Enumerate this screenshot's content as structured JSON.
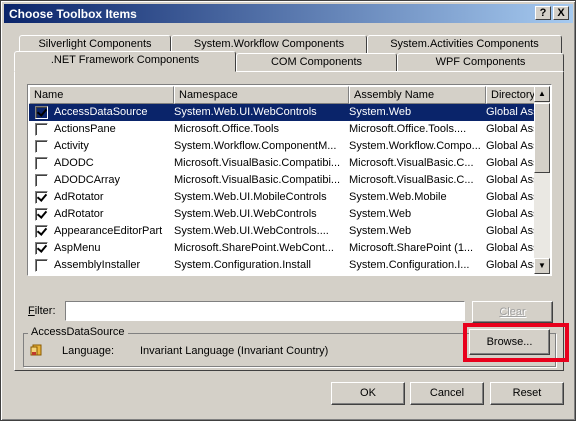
{
  "window": {
    "title": "Choose Toolbox Items",
    "help_label": "?",
    "close_label": "X"
  },
  "tabs_row1": [
    {
      "label": "Silverlight Components"
    },
    {
      "label": "System.Workflow Components"
    },
    {
      "label": "System.Activities Components"
    }
  ],
  "tabs_row2": [
    {
      "label": ".NET Framework Components",
      "active": true
    },
    {
      "label": "COM Components"
    },
    {
      "label": "WPF Components"
    }
  ],
  "list": {
    "columns": [
      "Name",
      "Namespace",
      "Assembly Name",
      "Directory"
    ],
    "rows": [
      {
        "checked": true,
        "name": "AccessDataSource",
        "namespace": "System.Web.UI.WebControls",
        "assembly": "System.Web",
        "directory": "Global Ass",
        "selected": true
      },
      {
        "checked": false,
        "name": "ActionsPane",
        "namespace": "Microsoft.Office.Tools",
        "assembly": "Microsoft.Office.Tools....",
        "directory": "Global Ass"
      },
      {
        "checked": false,
        "name": "Activity",
        "namespace": "System.Workflow.ComponentM...",
        "assembly": "System.Workflow.Compo...",
        "directory": "Global Ass"
      },
      {
        "checked": false,
        "name": "ADODC",
        "namespace": "Microsoft.VisualBasic.Compatibi...",
        "assembly": "Microsoft.VisualBasic.C...",
        "directory": "Global Ass"
      },
      {
        "checked": false,
        "name": "ADODCArray",
        "namespace": "Microsoft.VisualBasic.Compatibi...",
        "assembly": "Microsoft.VisualBasic.C...",
        "directory": "Global Ass"
      },
      {
        "checked": true,
        "name": "AdRotator",
        "namespace": "System.Web.UI.MobileControls",
        "assembly": "System.Web.Mobile",
        "directory": "Global Ass"
      },
      {
        "checked": true,
        "name": "AdRotator",
        "namespace": "System.Web.UI.WebControls",
        "assembly": "System.Web",
        "directory": "Global Ass"
      },
      {
        "checked": true,
        "name": "AppearanceEditorPart",
        "namespace": "System.Web.UI.WebControls....",
        "assembly": "System.Web",
        "directory": "Global Ass"
      },
      {
        "checked": true,
        "name": "AspMenu",
        "namespace": "Microsoft.SharePoint.WebCont...",
        "assembly": "Microsoft.SharePoint (1...",
        "directory": "Global Ass"
      },
      {
        "checked": false,
        "name": "AssemblyInstaller",
        "namespace": "System.Configuration.Install",
        "assembly": "System.Configuration.I...",
        "directory": "Global Ass"
      }
    ]
  },
  "filter": {
    "label_prefix": "F",
    "label_rest": "ilter:",
    "value": "",
    "clear_label": "Clear"
  },
  "details": {
    "group_title": "AccessDataSource",
    "language_label": "Language:",
    "language_value": "Invariant Language (Invariant Country)",
    "browse_label": "Browse..."
  },
  "footer": {
    "ok_label": "OK",
    "cancel_label": "Cancel",
    "reset_label": "Reset"
  },
  "colors": {
    "title_start": "#0a246a",
    "selection": "#0a246a",
    "highlight": "#e8001c"
  }
}
